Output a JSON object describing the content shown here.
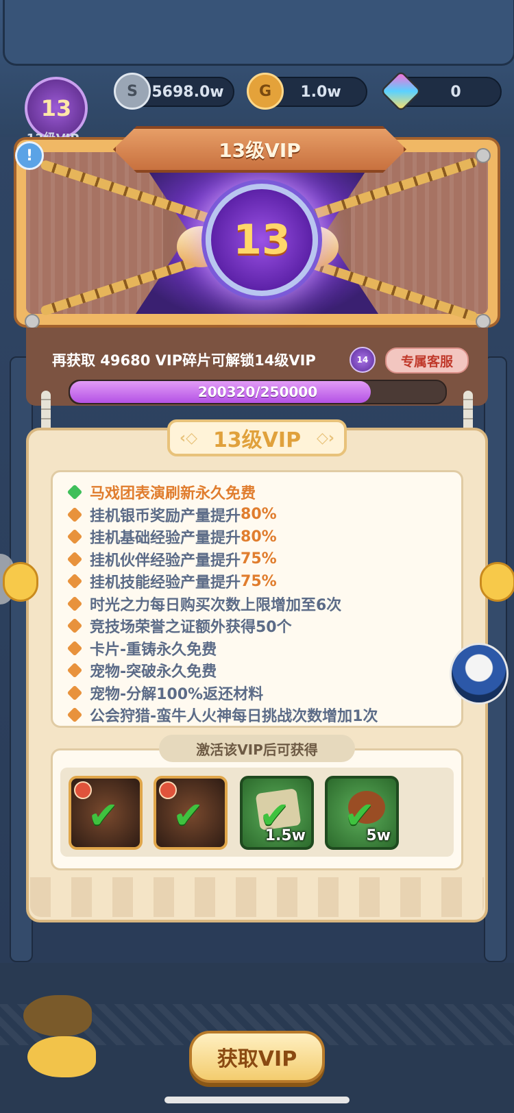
{
  "currencies": [
    {
      "name": "silver-coin",
      "value": "5698.0w"
    },
    {
      "name": "gold-coin",
      "value": "1.0w"
    },
    {
      "name": "gem",
      "value": "0"
    }
  ],
  "current_vip": {
    "level": "13",
    "label": "13级VIP"
  },
  "card": {
    "title": "13级VIP",
    "medal_level": "13"
  },
  "progress": {
    "unlock_text": "再获取 49680 VIP碎片可解锁14级VIP",
    "next_level_badge": "14",
    "service_button": "专属客服",
    "current": 200320,
    "max": 250000,
    "text": "200320/250000"
  },
  "scroll_title": "13级VIP",
  "benefits": [
    {
      "pre": "马戏团表演刷新永久免费",
      "hl": "",
      "style": "green"
    },
    {
      "pre": "挂机银币奖励产量提升",
      "hl": "80%",
      "style": "normal"
    },
    {
      "pre": "挂机基础经验产量提升",
      "hl": "80%",
      "style": "normal"
    },
    {
      "pre": "挂机伙伴经验产量提升",
      "hl": "75%",
      "style": "normal"
    },
    {
      "pre": "挂机技能经验产量提升",
      "hl": "75%",
      "style": "normal"
    },
    {
      "pre": "时光之力每日购买次数上限增加至6次",
      "hl": "",
      "style": "normal"
    },
    {
      "pre": "竞技场荣誉之证额外获得50个",
      "hl": "",
      "style": "normal"
    },
    {
      "pre": "卡片-重铸永久免费",
      "hl": "",
      "style": "normal"
    },
    {
      "pre": "宠物-突破永久免费",
      "hl": "",
      "style": "normal"
    },
    {
      "pre": "宠物-分解100%返还材料",
      "hl": "",
      "style": "normal"
    },
    {
      "pre": "公会狩猎-蛮牛人火神每日挑战次数增加1次",
      "hl": "",
      "style": "normal"
    }
  ],
  "reward_header": "激活该VIP后可获得",
  "rewards": [
    {
      "type": "hero",
      "qty": ""
    },
    {
      "type": "hero",
      "qty": ""
    },
    {
      "type": "scroll",
      "qty": "1.5w"
    },
    {
      "type": "meat",
      "qty": "5w"
    }
  ],
  "get_vip_button": "获取VIP",
  "colors": {
    "accent": "#e07d2e",
    "progress": "#b452e5",
    "benefit_text": "#5b6b87"
  }
}
